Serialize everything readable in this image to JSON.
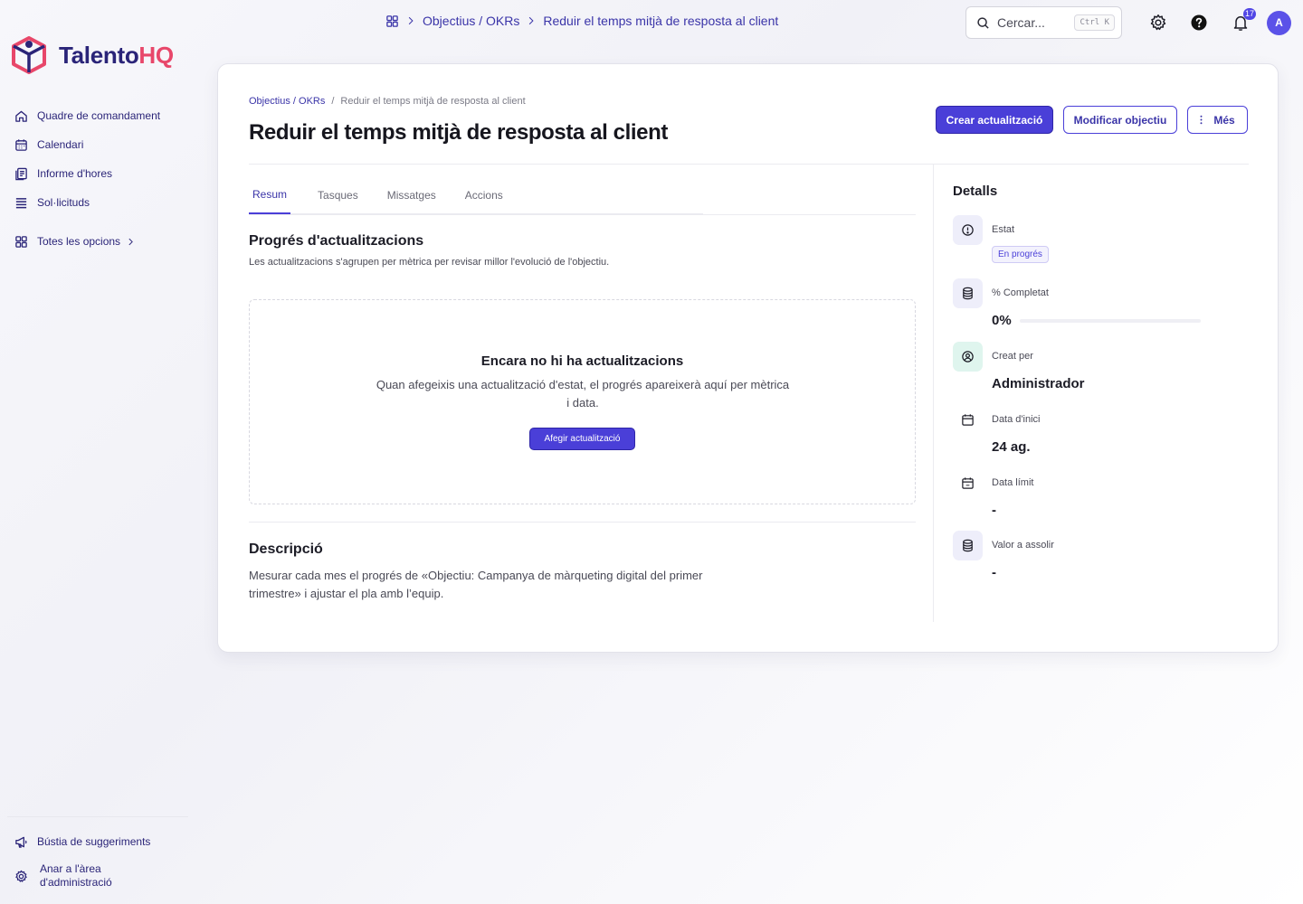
{
  "brand": {
    "name_main": "Talento",
    "name_accent": "HQ"
  },
  "sidebar": {
    "items": [
      {
        "label": "Quadre de comandament",
        "icon": "home-icon"
      },
      {
        "label": "Calendari",
        "icon": "calendar-icon"
      },
      {
        "label": "Informe d'hores",
        "icon": "report-icon"
      },
      {
        "label": "Sol·licituds",
        "icon": "list-icon"
      },
      {
        "label": "Totes les opcions",
        "icon": "grid-icon"
      }
    ],
    "bottom": [
      {
        "label": "Bústia de suggeriments",
        "icon": "megaphone-icon"
      },
      {
        "label": "Anar a l'àrea d'administració",
        "icon": "gear-icon"
      }
    ]
  },
  "topbar": {
    "breadcrumb": [
      "Objectius / OKRs",
      "Reduir el temps mitjà de resposta al client"
    ],
    "search_placeholder": "Cercar...",
    "search_shortcut": "Ctrl K",
    "notifications_count": "17",
    "avatar_initial": "A"
  },
  "page": {
    "breadcrumb_link": "Objectius / OKRs",
    "breadcrumb_sep": "/",
    "breadcrumb_current": "Reduir el temps mitjà de resposta al client",
    "title": "Reduir el temps mitjà de resposta al client",
    "actions": {
      "create_update": "Crear actualització",
      "edit_objective": "Modificar objectiu",
      "more": "Més"
    },
    "tabs": [
      "Resum",
      "Tasques",
      "Missatges",
      "Accions"
    ],
    "progress_section": {
      "title": "Progrés d'actualitzacions",
      "subtitle": "Les actualitzacions s'agrupen per mètrica per revisar millor l'evolució de l'objectiu.",
      "empty_title": "Encara no hi ha actualitzacions",
      "empty_text": "Quan afegeixis una actualització d'estat, el progrés apareixerà aquí per mètrica i data.",
      "empty_button": "Afegir actualització"
    },
    "description": {
      "title": "Descripció",
      "text": "Mesurar cada mes el progrés de «Objectiu: Campanya de màrqueting digital del primer trimestre» i ajustar el pla amb l’equip."
    }
  },
  "details": {
    "title": "Detalls",
    "status_label": "Estat",
    "status_value": "En progrés",
    "completed_label": "% Completat",
    "completed_value": "0%",
    "completed_fraction": 0,
    "created_by_label": "Creat per",
    "created_by_value": "Administrador",
    "start_label": "Data d'inici",
    "start_value": "24 ag.",
    "deadline_label": "Data límit",
    "deadline_value": "-",
    "target_label": "Valor a assolir",
    "target_value": "-"
  },
  "colors": {
    "accent": "#4a3fd8",
    "brand_dark": "#2a2478",
    "brand_pink": "#e8476a"
  }
}
